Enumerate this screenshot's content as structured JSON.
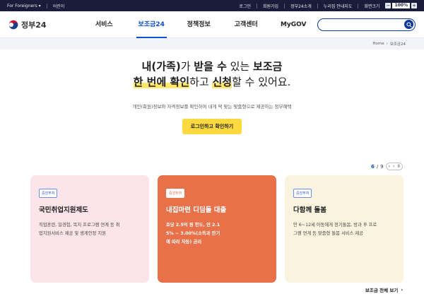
{
  "topbar": {
    "left": [
      "For Foreigners ▾",
      "어린이"
    ],
    "right": [
      "로그인",
      "회원가입",
      "정부24소개",
      "누리집 안내지도",
      "화면크기"
    ],
    "zoom": {
      "minus": "−",
      "value": "100%",
      "plus": "+"
    }
  },
  "header": {
    "logo_text": "정부24",
    "nav": [
      "서비스",
      "보조금24",
      "정책정보",
      "고객센터",
      "MyGOV"
    ],
    "active_nav_index": 1,
    "search_placeholder": ""
  },
  "breadcrumb": [
    "Home",
    "보조금24"
  ],
  "hero": {
    "line1_parts": [
      "내(가족)",
      "가 ",
      "받을 수",
      " 있는 ",
      "보조금"
    ],
    "line2_parts": [
      "한 번에 확인",
      "하고 ",
      "신청",
      "할 수 있어요."
    ],
    "description": "개인(회원)정보와 자격정보를 확인하여 내게 딱 맞는 맞춤형으로 제공하는 정부혜택",
    "login_button": "로그인하고 확인하기"
  },
  "pager": {
    "current": "6",
    "total": "9",
    "prev": "‹",
    "next": "›",
    "pause": "II"
  },
  "cards": [
    {
      "badge": "중앙부처",
      "title": "국민취업지원제도",
      "desc_lines": [
        "직업훈련, 일경험, 복지 프로그램 연계 등 취",
        "업지원서비스 제공 및 생계안정 지원"
      ],
      "color": "#fbe4ea"
    },
    {
      "badge": "중앙부처",
      "title": "내집마련 디딤돌 대출",
      "desc_lines": [
        "호당 2.5억 원 한도, 연 2.1",
        "5% ~ 3.00%(소득과 만기",
        "에 따라 차등) 금리"
      ],
      "color": "#e8714a"
    },
    {
      "badge": "중앙부처",
      "title": "다함께 돌봄",
      "desc_lines": [
        "만 6~12세 아동에게 정기돌봄, 방과 후 프로",
        "그램 연계 등 맞춤형 돌봄 서비스 제공"
      ],
      "color": "#faf3df"
    }
  ],
  "more_link": "보조금 전체 보기"
}
